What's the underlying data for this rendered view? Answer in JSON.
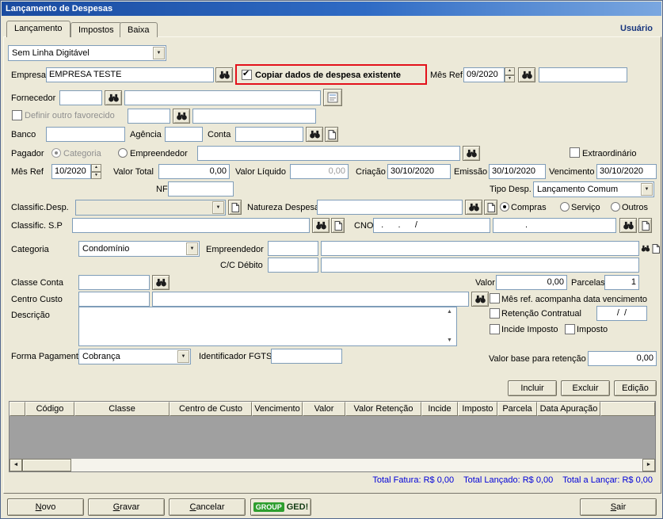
{
  "window": {
    "title": "Lançamento de Despesas"
  },
  "tabs": {
    "lancamento": "Lançamento",
    "impostos": "Impostos",
    "baixa": "Baixa",
    "user": "Usuário"
  },
  "linha_digitavel": {
    "selected": "Sem Linha Digitável"
  },
  "empresa": {
    "label": "Empresa",
    "value": "EMPRESA TESTE",
    "copy_checkbox": "Copiar dados de despesa existente",
    "mes_ref_label": "Mês Ref",
    "mes_ref": "09/2020",
    "aux": ""
  },
  "fornecedor": {
    "label": "Fornecedor",
    "code": "",
    "name": ""
  },
  "favorecido": {
    "checkbox": "Definir outro favorecido",
    "code": "",
    "name": ""
  },
  "banco": {
    "label": "Banco",
    "value": "",
    "agencia_label": "Agência",
    "agencia": "",
    "conta_label": "Conta",
    "conta": ""
  },
  "pagador": {
    "label": "Pagador",
    "radio_categoria": "Categoria",
    "radio_empreendedor": "Empreendedor",
    "value": "",
    "extraordinario": "Extraordinário"
  },
  "datas": {
    "mes_ref_label": "Mês Ref",
    "mes_ref": "10/2020",
    "valor_total_label": "Valor Total",
    "valor_total": "0,00",
    "valor_liquido_label": "Valor Líquido",
    "valor_liquido": "0,00",
    "criacao_label": "Criação",
    "criacao": "30/10/2020",
    "emissao_label": "Emissão",
    "emissao": "30/10/2020",
    "vencimento_label": "Vencimento",
    "vencimento": "30/10/2020"
  },
  "nf": {
    "label": "NF",
    "value": ""
  },
  "tipo_desp": {
    "label": "Tipo Desp.",
    "selected": "Lançamento Comum"
  },
  "classific_desp": {
    "label": "Classific.Desp.",
    "selected": ""
  },
  "natureza": {
    "label": "Natureza Despesa",
    "value": ""
  },
  "tipo_compra": {
    "compras": "Compras",
    "servico": "Serviço",
    "outros": "Outros"
  },
  "classific_sp": {
    "label": "Classific. S.P",
    "value": ""
  },
  "cno": {
    "label": "CNO",
    "mask": "  .      .      /",
    "aux": "."
  },
  "categoria": {
    "label": "Categoria",
    "selected": "Condomínio"
  },
  "empreendedor": {
    "label": "Empreendedor",
    "code": "",
    "name": ""
  },
  "cc_debito": {
    "label": "C/C Débito",
    "code": "",
    "name": ""
  },
  "classe_conta": {
    "label": "Classe Conta",
    "value": ""
  },
  "valor": {
    "label": "Valor",
    "value": "0,00"
  },
  "parcelas": {
    "label": "Parcelas",
    "value": "1"
  },
  "centro_custo": {
    "label": "Centro Custo",
    "code": "",
    "name": ""
  },
  "mes_ref_check": "Mês ref. acompanha data vencimento",
  "descricao": {
    "label": "Descrição",
    "value": ""
  },
  "retencao": {
    "checkbox": "Retenção Contratual",
    "date": "/  /"
  },
  "incide_imposto": "Incide Imposto",
  "imposto": "Imposto",
  "forma_pagamento": {
    "label": "Forma Pagamento",
    "selected": "Cobrança"
  },
  "fgts": {
    "label": "Identificador FGTS",
    "value": ""
  },
  "retencao_base": {
    "label": "Valor base para retenção",
    "value": "0,00"
  },
  "actions": {
    "incluir": "Incluir",
    "excluir": "Excluir",
    "edicao": "Edição"
  },
  "grid": {
    "columns": [
      "",
      "Código",
      "Classe",
      "Centro de Custo",
      "Vencimento",
      "Valor",
      "Valor Retenção",
      "Incide",
      "Imposto",
      "Parcela",
      "Data Apuração"
    ],
    "rows": []
  },
  "totals": {
    "fatura": "Total Fatura: R$ 0,00",
    "lancado": "Total Lançado: R$ 0,00",
    "a_lancar": "Total a Lançar: R$ 0,00"
  },
  "footer": {
    "novo": "Novo",
    "gravar": "Gravar",
    "cancelar": "Cancelar",
    "ged_group": "GROUP",
    "ged": "GED!",
    "sair": "Sair"
  },
  "icons": {
    "spinner_up": "▲",
    "spinner_down": "▼",
    "combo_arrow": "▼",
    "check": "✔",
    "scroll_left": "◄",
    "scroll_right": "►"
  },
  "colors": {
    "annotation_red": "#e3111b",
    "totals_blue": "#0000d8",
    "user_blue": "#17357e",
    "ged_green": "#2e9e2e"
  }
}
